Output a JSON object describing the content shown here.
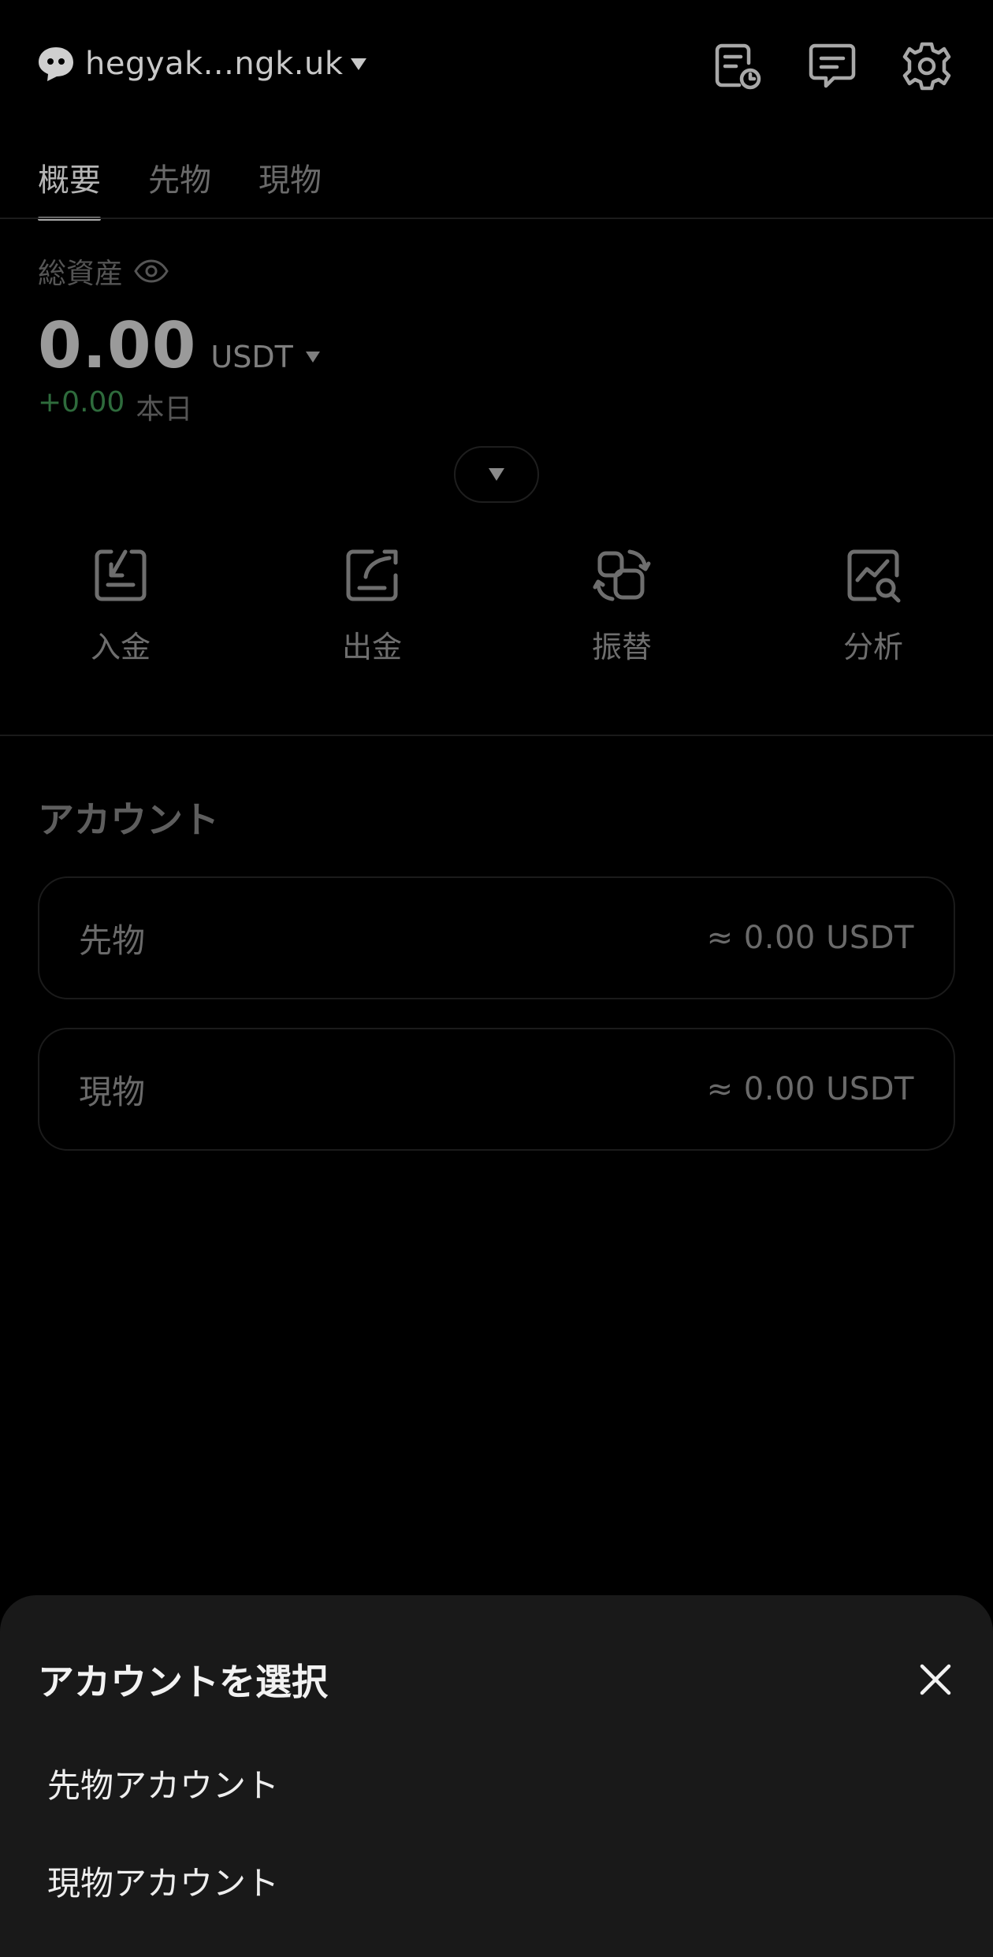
{
  "header": {
    "account_name": "hegyak...ngk.uk",
    "icons": [
      "orders-history-icon",
      "messages-icon",
      "settings-icon"
    ]
  },
  "tabs": [
    {
      "label": "概要",
      "active": true
    },
    {
      "label": "先物",
      "active": false
    },
    {
      "label": "現物",
      "active": false
    }
  ],
  "assets": {
    "total_label": "総資産",
    "balance": "0.00",
    "currency": "USDT",
    "pnl_value": "+0.00",
    "pnl_label": "本日"
  },
  "actions": [
    {
      "label": "入金",
      "icon": "deposit-icon"
    },
    {
      "label": "出金",
      "icon": "withdraw-icon"
    },
    {
      "label": "振替",
      "icon": "transfer-icon"
    },
    {
      "label": "分析",
      "icon": "analysis-icon"
    }
  ],
  "accounts": {
    "title": "アカウント",
    "items": [
      {
        "name": "先物",
        "value": "≈ 0.00 USDT"
      },
      {
        "name": "現物",
        "value": "≈ 0.00 USDT"
      }
    ]
  },
  "sheet": {
    "title": "アカウントを選択",
    "options": [
      "先物アカウント",
      "現物アカウント"
    ]
  },
  "colors": {
    "background": "#000000",
    "sheet_background": "#191919",
    "pnl_positive": "#2e6b3c"
  }
}
